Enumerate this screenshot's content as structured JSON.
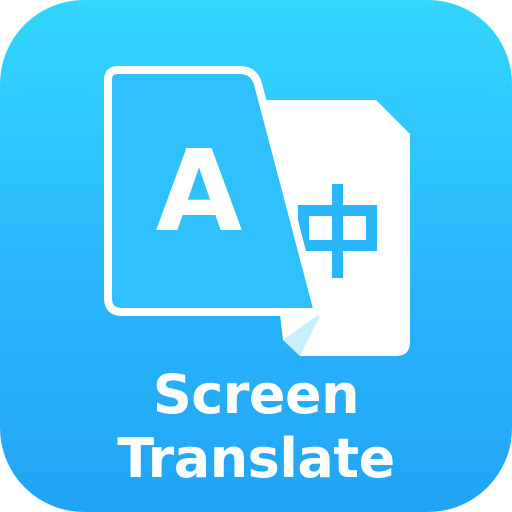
{
  "app": {
    "name_line1": "Screen",
    "name_line2": "Translate"
  },
  "logo": {
    "source_glyph": "A",
    "target_glyph": "中"
  },
  "icons": {
    "source_document": "document-latin-icon",
    "target_document": "document-chinese-icon"
  },
  "colors": {
    "tile_top": "#33d6ff",
    "tile_bottom": "#21a4f5",
    "page_white": "#ffffff",
    "fold_light": "#c8efff"
  }
}
